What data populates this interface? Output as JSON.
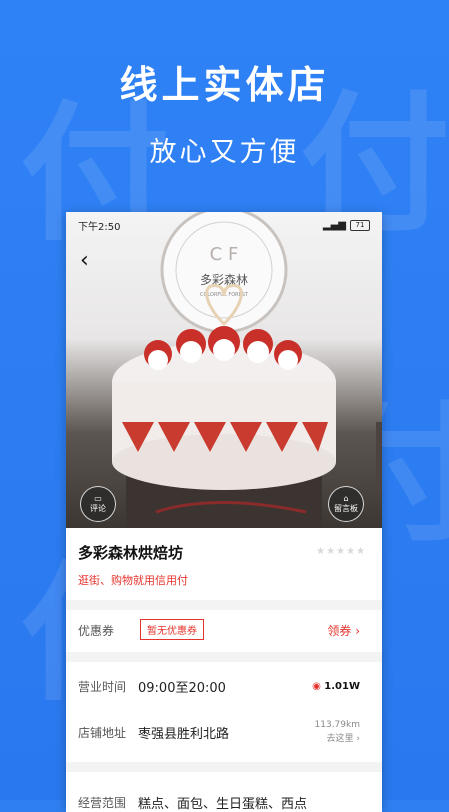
{
  "headline": {
    "title": "线上实体店",
    "subtitle": "放心又方便"
  },
  "watermark": "付",
  "status_bar": {
    "time": "下午2:50",
    "battery": "71"
  },
  "photo": {
    "logo_text": "多彩森林",
    "logo_en": "COLORFUL FOREST",
    "comment_btn": "评论",
    "inn_btn": "留言板"
  },
  "store": {
    "name": "多彩森林烘焙坊",
    "tagline": "逛街、购物就用信用付"
  },
  "coupon": {
    "label": "优惠券",
    "tag": "暂无优惠券",
    "link": "领券 ›"
  },
  "hours": {
    "label": "营业时间",
    "value": "09:00至20:00",
    "hot": "1.01W"
  },
  "address": {
    "label": "店铺地址",
    "value": "枣强县胜利北路",
    "distance": "113.79km",
    "goto": "去这里 ›"
  },
  "scope": {
    "label": "经营范围",
    "value": "糕点、面包、生日蛋糕、西点"
  }
}
